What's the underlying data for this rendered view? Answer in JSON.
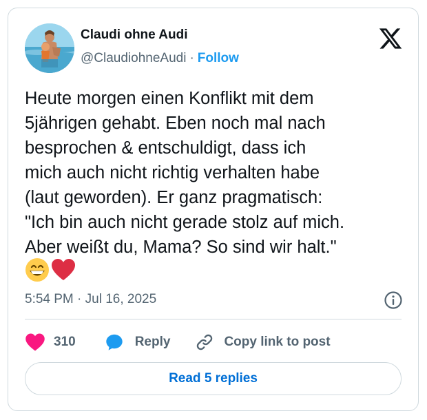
{
  "author": {
    "name": "Claudi ohne Audi",
    "handle": "@ClaudiohneAudi",
    "separator": "·",
    "follow_label": "Follow"
  },
  "brand": {
    "logo_icon": "x-logo-icon"
  },
  "tweet": {
    "text": "Heute morgen einen Konflikt mit dem\n5jährigen gehabt. Eben noch mal nach\nbesprochen & entschuldigt, dass ich\nmich auch nicht richtig verhalten habe\n(laut geworden). Er ganz pragmatisch:\n\"Ich bin auch nicht gerade stolz auf mich.\nAber weißt du, Mama? So sind wir halt.\"",
    "emojis": [
      "grinning-face-emoji",
      "red-heart-emoji"
    ],
    "timestamp": "5:54 PM · Jul 16, 2025"
  },
  "actions": {
    "like_count": "310",
    "reply_label": "Reply",
    "copy_label": "Copy link to post"
  },
  "footer": {
    "read_replies_label": "Read 5 replies"
  },
  "colors": {
    "accent": "#1d9bf0",
    "like": "#f91880",
    "text": "#0f1419",
    "muted": "#536471",
    "border": "#cfd9de"
  }
}
